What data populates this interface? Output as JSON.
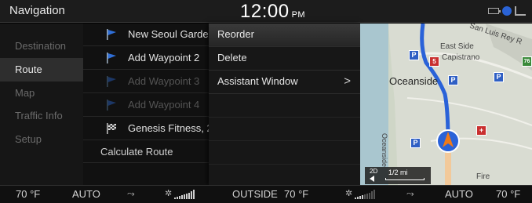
{
  "header": {
    "title": "Navigation",
    "time": "12:00",
    "ampm": "PM",
    "status_icons": [
      "battery-icon",
      "bluetooth-icon",
      "signal-icon"
    ]
  },
  "sidebar": {
    "items": [
      {
        "label": "Destination",
        "active": false
      },
      {
        "label": "Route",
        "active": true
      },
      {
        "label": "Map",
        "active": false
      },
      {
        "label": "Traffic Info",
        "active": false
      },
      {
        "label": "Setup",
        "active": false
      }
    ]
  },
  "route": {
    "rows": [
      {
        "label": "New Seoul Garde",
        "icon": "waypoint-flag-icon",
        "enabled": true
      },
      {
        "label": "Add Waypoint 2",
        "icon": "waypoint-flag-icon",
        "enabled": true
      },
      {
        "label": "Add Waypoint 3",
        "icon": "waypoint-flag-icon",
        "enabled": false
      },
      {
        "label": "Add Waypoint 4",
        "icon": "waypoint-flag-icon",
        "enabled": false
      },
      {
        "label": "Genesis Fitness, 2",
        "icon": "destination-checkered-flag-icon",
        "enabled": true
      }
    ],
    "calculate_label": "Calculate Route"
  },
  "menu": {
    "items": [
      {
        "label": "Reorder",
        "selected": true,
        "has_submenu": false
      },
      {
        "label": "Delete",
        "selected": false,
        "has_submenu": false
      },
      {
        "label": "Assistant Window",
        "selected": false,
        "has_submenu": true
      }
    ],
    "submenu_glyph": ">"
  },
  "map": {
    "labels": {
      "east_side": "East Side",
      "capistrano": "Capistrano",
      "san_luis_rey": "San Luis Rey R",
      "oceanside": "Oceanside",
      "oceanside_blvd": "Oceanside",
      "fire": "Fire",
      "route_5": "5",
      "route_76": "76"
    },
    "scale": {
      "mode": "2D",
      "distance": "1/2 mi"
    },
    "colors": {
      "route": "#2a62d8",
      "land": "#d9dcd2",
      "water": "#a9c6cf",
      "road": "#f2c99a"
    }
  },
  "climate": {
    "left_temp": "70 °F",
    "left_mode": "AUTO",
    "outside_label": "OUTSIDE",
    "outside_temp": "70 °F",
    "right_mode": "AUTO",
    "right_temp": "70 °F"
  }
}
